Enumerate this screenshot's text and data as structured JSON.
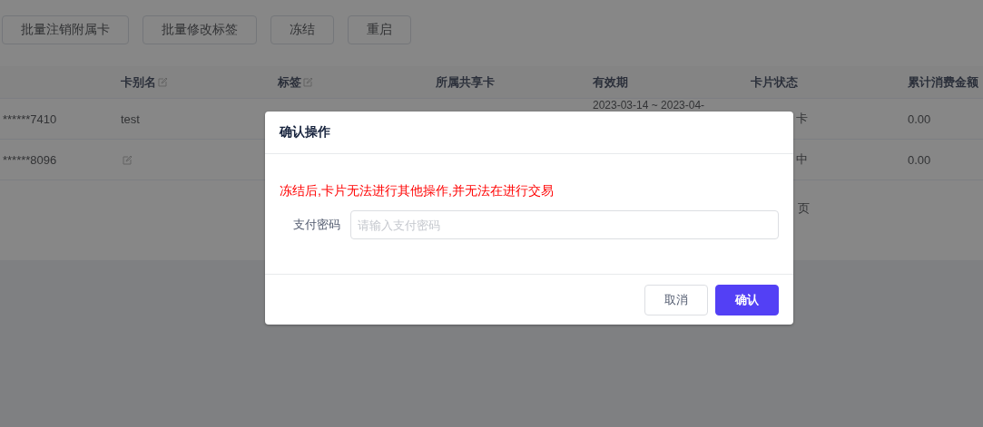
{
  "toolbar": {
    "buttons": [
      "批量注销附属卡",
      "批量修改标签",
      "冻结",
      "重启"
    ]
  },
  "table": {
    "columns": [
      {
        "label": "卡别名",
        "editable": true
      },
      {
        "label": "标签",
        "editable": true
      },
      {
        "label": "所属共享卡",
        "editable": false
      },
      {
        "label": "有效期",
        "editable": false
      },
      {
        "label": "卡片状态",
        "editable": false
      },
      {
        "label": "累计消费金额",
        "editable": false
      }
    ],
    "rows": [
      {
        "card_number": "******7410",
        "alias": "test",
        "alias_editable": false,
        "validity": "2023-03-14 ~ 2023-04-",
        "status": "卡",
        "total_spent": "0.00"
      },
      {
        "card_number": "******8096",
        "alias_editable": true,
        "status": "中",
        "total_spent": "0.00"
      }
    ]
  },
  "pagination": {
    "text": "页"
  },
  "dialog": {
    "title": "确认操作",
    "warning": "冻结后,卡片无法进行其他操作,并无法在进行交易",
    "field": {
      "label": "支付密码",
      "placeholder": "请输入支付密码"
    },
    "buttons": [
      {
        "label": "取消",
        "kind": "default"
      },
      {
        "label": "确认",
        "kind": "primary"
      }
    ]
  }
}
